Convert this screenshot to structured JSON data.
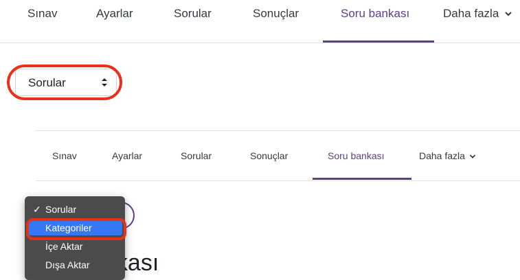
{
  "top_nav": {
    "tabs": [
      "Sınav",
      "Ayarlar",
      "Sorular",
      "Sonuçlar",
      "Soru bankası",
      "Daha fazla"
    ],
    "active_tab": "Soru bankası"
  },
  "question_select": {
    "value": "Sorular"
  },
  "inner_nav": {
    "tabs": [
      "Sınav",
      "Ayarlar",
      "Sorular",
      "Sonuçlar",
      "Soru bankası",
      "Daha fazla"
    ],
    "active_tab": "Soru bankası"
  },
  "dropdown_menu": {
    "items": [
      "Sorular",
      "Kategoriler",
      "İçe Aktar",
      "Dışa Aktar"
    ],
    "checked": "Sorular",
    "hovered": "Kategoriler"
  },
  "page_heading_fragment": "nkası",
  "colors": {
    "accent": "#5c3e8b",
    "highlight": "#e8311a",
    "menu_bg": "#4b4b4b",
    "menu_selected": "#3478f6"
  }
}
